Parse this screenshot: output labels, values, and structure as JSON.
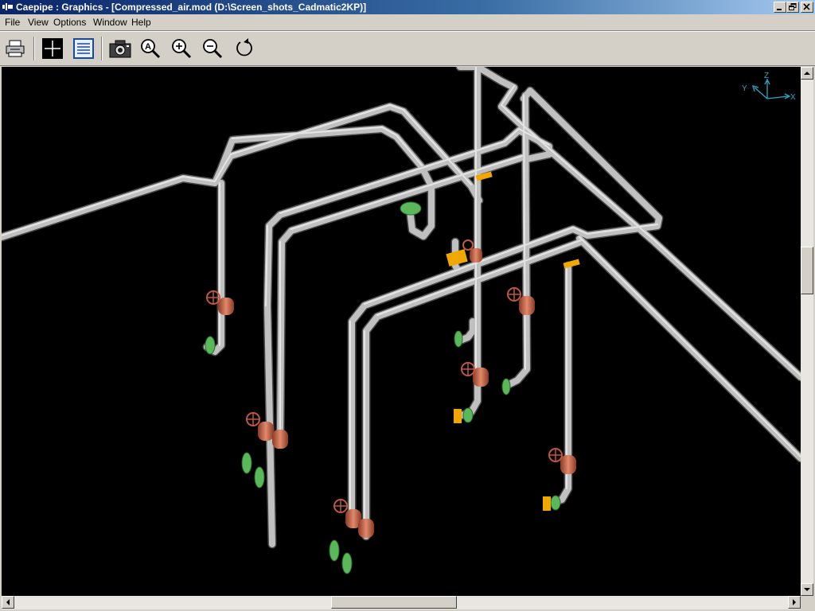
{
  "window": {
    "title": "Caepipe : Graphics - [Compressed_air.mod (D:\\Screen_shots_Cadmatic2KP)]"
  },
  "menu": {
    "items": [
      "File",
      "View",
      "Options",
      "Window",
      "Help"
    ]
  },
  "toolbar": {
    "buttons": [
      "print-icon",
      "crosshair-icon",
      "list-icon",
      "camera-icon",
      "zoom-auto-icon",
      "zoom-in-icon",
      "zoom-out-icon",
      "rotate-icon"
    ]
  },
  "viewport": {
    "background": "#000000",
    "pipe_color": "#b8b8b8",
    "valve_color": "#c86448",
    "flange_color": "#5ab85a",
    "support_color": "#f0a800",
    "axis_color": "#2aa8c8",
    "axes": {
      "z": "Z",
      "y": "Y",
      "x": "X"
    }
  }
}
